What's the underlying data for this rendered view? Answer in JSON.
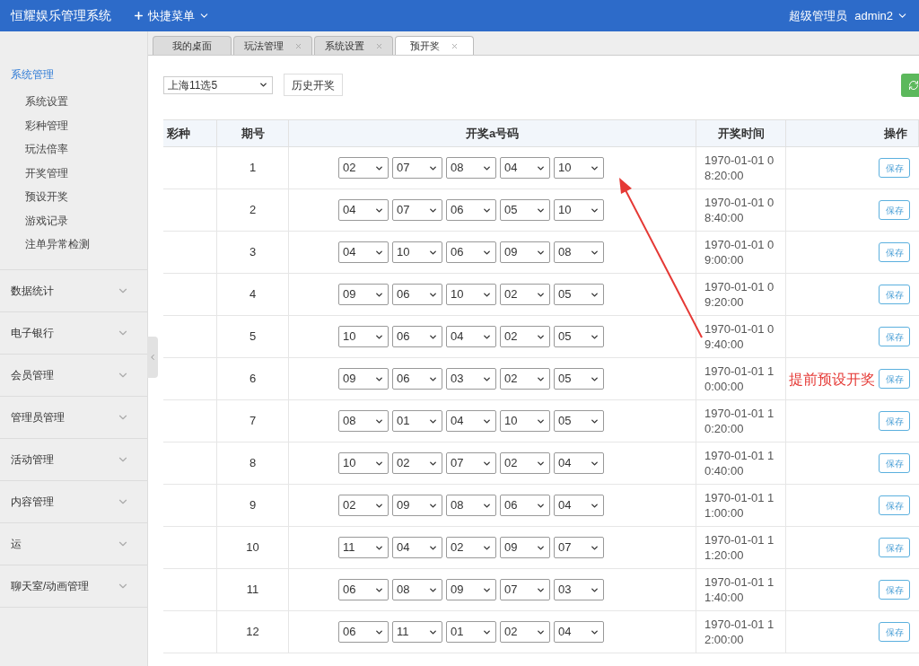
{
  "header": {
    "title": "恒耀娱乐管理系统",
    "quick_menu": "快捷菜单",
    "role": "超级管理员",
    "user": "admin2"
  },
  "sidebar": {
    "items": [
      {
        "label": "系统管理",
        "selected": true,
        "expanded": true,
        "children": [
          {
            "label": "系统设置"
          },
          {
            "label": "彩种管理"
          },
          {
            "label": "玩法倍率"
          },
          {
            "label": "开奖管理"
          },
          {
            "label": "预设开奖"
          },
          {
            "label": "游戏记录"
          },
          {
            "label": "注单异常检测"
          }
        ]
      },
      {
        "label": "数据统计",
        "selected": false,
        "expanded": false
      },
      {
        "label": "电子银行",
        "selected": false,
        "expanded": false
      },
      {
        "label": "会员管理",
        "selected": false,
        "expanded": false
      },
      {
        "label": "管理员管理",
        "selected": false,
        "expanded": false
      },
      {
        "label": "活动管理",
        "selected": false,
        "expanded": false
      },
      {
        "label": "内容管理",
        "selected": false,
        "expanded": false
      },
      {
        "label": "运",
        "selected": false,
        "expanded": false
      },
      {
        "label": "聊天室/动画管理",
        "selected": false,
        "expanded": false
      }
    ]
  },
  "tabs": [
    {
      "label": "我的桌面",
      "closable": false,
      "selected": false
    },
    {
      "label": "玩法管理",
      "closable": true,
      "selected": false
    },
    {
      "label": "系统设置",
      "closable": true,
      "selected": false
    },
    {
      "label": "预开奖",
      "closable": true,
      "selected": true
    }
  ],
  "toolbar": {
    "lottery_select": "上海11选5",
    "history_button": "历史开奖"
  },
  "table": {
    "columns": [
      "彩种",
      "期号",
      "开奖a号码",
      "开奖时间",
      "操作"
    ],
    "rows": [
      {
        "period": "1",
        "numbers": [
          "02",
          "07",
          "08",
          "04",
          "10"
        ],
        "time": "1970-01-01 08:20:00",
        "action": "保存"
      },
      {
        "period": "2",
        "numbers": [
          "04",
          "07",
          "06",
          "05",
          "10"
        ],
        "time": "1970-01-01 08:40:00",
        "action": "保存"
      },
      {
        "period": "3",
        "numbers": [
          "04",
          "10",
          "06",
          "09",
          "08"
        ],
        "time": "1970-01-01 09:00:00",
        "action": "保存"
      },
      {
        "period": "4",
        "numbers": [
          "09",
          "06",
          "10",
          "02",
          "05"
        ],
        "time": "1970-01-01 09:20:00",
        "action": "保存"
      },
      {
        "period": "5",
        "numbers": [
          "10",
          "06",
          "04",
          "02",
          "05"
        ],
        "time": "1970-01-01 09:40:00",
        "action": "保存"
      },
      {
        "period": "6",
        "numbers": [
          "09",
          "06",
          "03",
          "02",
          "05"
        ],
        "time": "1970-01-01 10:00:00",
        "action": "保存"
      },
      {
        "period": "7",
        "numbers": [
          "08",
          "01",
          "04",
          "10",
          "05"
        ],
        "time": "1970-01-01 10:20:00",
        "action": "保存"
      },
      {
        "period": "8",
        "numbers": [
          "10",
          "02",
          "07",
          "02",
          "04"
        ],
        "time": "1970-01-01 10:40:00",
        "action": "保存"
      },
      {
        "period": "9",
        "numbers": [
          "02",
          "09",
          "08",
          "06",
          "04"
        ],
        "time": "1970-01-01 11:00:00",
        "action": "保存"
      },
      {
        "period": "10",
        "numbers": [
          "11",
          "04",
          "02",
          "09",
          "07"
        ],
        "time": "1970-01-01 11:20:00",
        "action": "保存"
      },
      {
        "period": "11",
        "numbers": [
          "06",
          "08",
          "09",
          "07",
          "03"
        ],
        "time": "1970-01-01 11:40:00",
        "action": "保存"
      },
      {
        "period": "12",
        "numbers": [
          "06",
          "11",
          "01",
          "02",
          "04"
        ],
        "time": "1970-01-01 12:00:00",
        "action": "保存"
      }
    ]
  },
  "annotation": {
    "text": "提前预设开奖"
  }
}
